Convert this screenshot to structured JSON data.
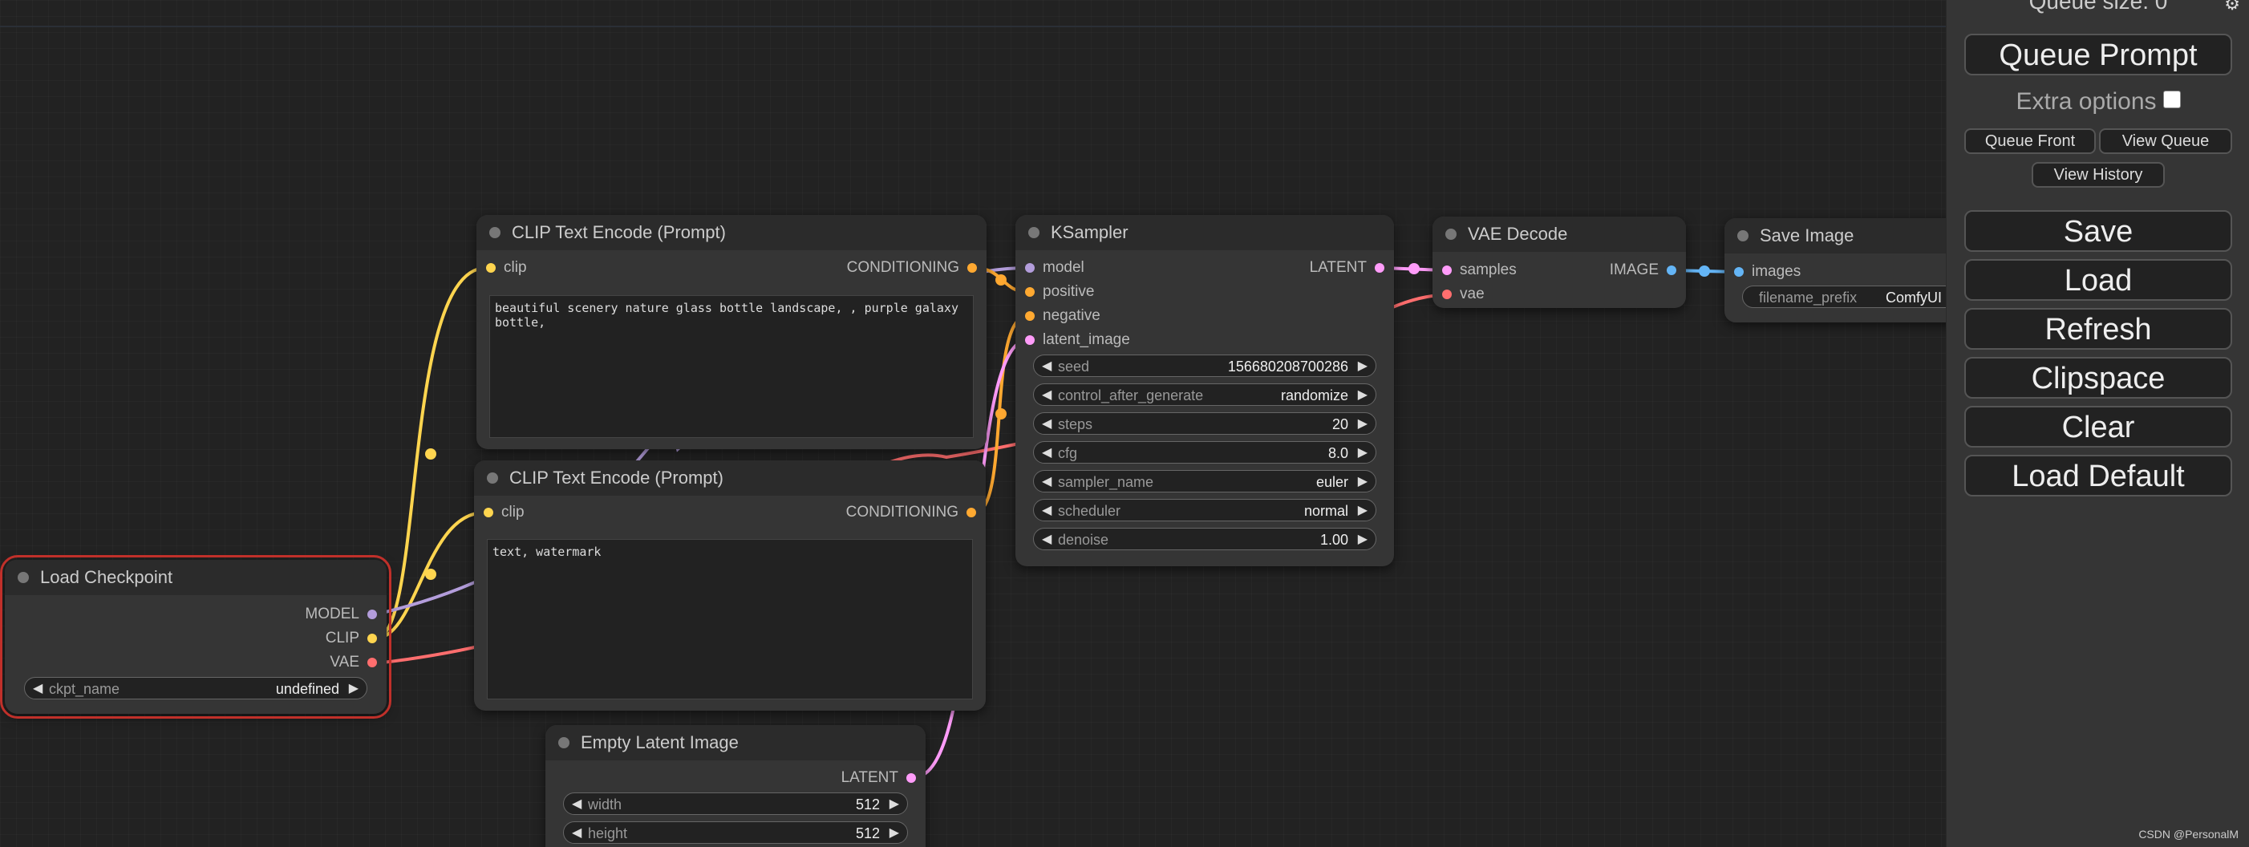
{
  "colors": {
    "model": "#b39ddb",
    "clip": "#ffd54f",
    "vae": "#ff6e6e",
    "conditioning": "#ffa931",
    "latent": "#ff9cf9",
    "image": "#64b5f6"
  },
  "nodes": {
    "clip_pos": {
      "title": "CLIP Text Encode (Prompt)",
      "input_clip": "clip",
      "output_conditioning": "CONDITIONING",
      "text": "beautiful scenery nature glass bottle landscape, , purple galaxy bottle,"
    },
    "clip_neg": {
      "title": "CLIP Text Encode (Prompt)",
      "input_clip": "clip",
      "output_conditioning": "CONDITIONING",
      "text": "text, watermark"
    },
    "load_checkpoint": {
      "title": "Load Checkpoint",
      "outputs": [
        "MODEL",
        "CLIP",
        "VAE"
      ],
      "widget_label": "ckpt_name",
      "widget_value": "undefined"
    },
    "ksampler": {
      "title": "KSampler",
      "inputs": [
        "model",
        "positive",
        "negative",
        "latent_image"
      ],
      "output": "LATENT",
      "widgets": [
        {
          "label": "seed",
          "value": "156680208700286"
        },
        {
          "label": "control_after_generate",
          "value": "randomize"
        },
        {
          "label": "steps",
          "value": "20"
        },
        {
          "label": "cfg",
          "value": "8.0"
        },
        {
          "label": "sampler_name",
          "value": "euler"
        },
        {
          "label": "scheduler",
          "value": "normal"
        },
        {
          "label": "denoise",
          "value": "1.00"
        }
      ]
    },
    "vae_decode": {
      "title": "VAE Decode",
      "inputs": [
        "samples",
        "vae"
      ],
      "output": "IMAGE"
    },
    "save_image": {
      "title": "Save Image",
      "input": "images",
      "widget_label": "filename_prefix",
      "widget_value": "ComfyUI"
    },
    "empty_latent": {
      "title": "Empty Latent Image",
      "output": "LATENT",
      "widgets": [
        {
          "label": "width",
          "value": "512"
        },
        {
          "label": "height",
          "value": "512"
        }
      ]
    }
  },
  "menu": {
    "queue_size": "Queue size: 0",
    "gear_icon": "⚙",
    "queue_prompt": "Queue Prompt",
    "extra_options": "Extra options",
    "queue_front": "Queue Front",
    "view_queue": "View Queue",
    "view_history": "View History",
    "save": "Save",
    "load": "Load",
    "refresh": "Refresh",
    "clipspace": "Clipspace",
    "clear": "Clear",
    "load_default": "Load Default"
  },
  "watermark": "CSDN @PersonalM"
}
